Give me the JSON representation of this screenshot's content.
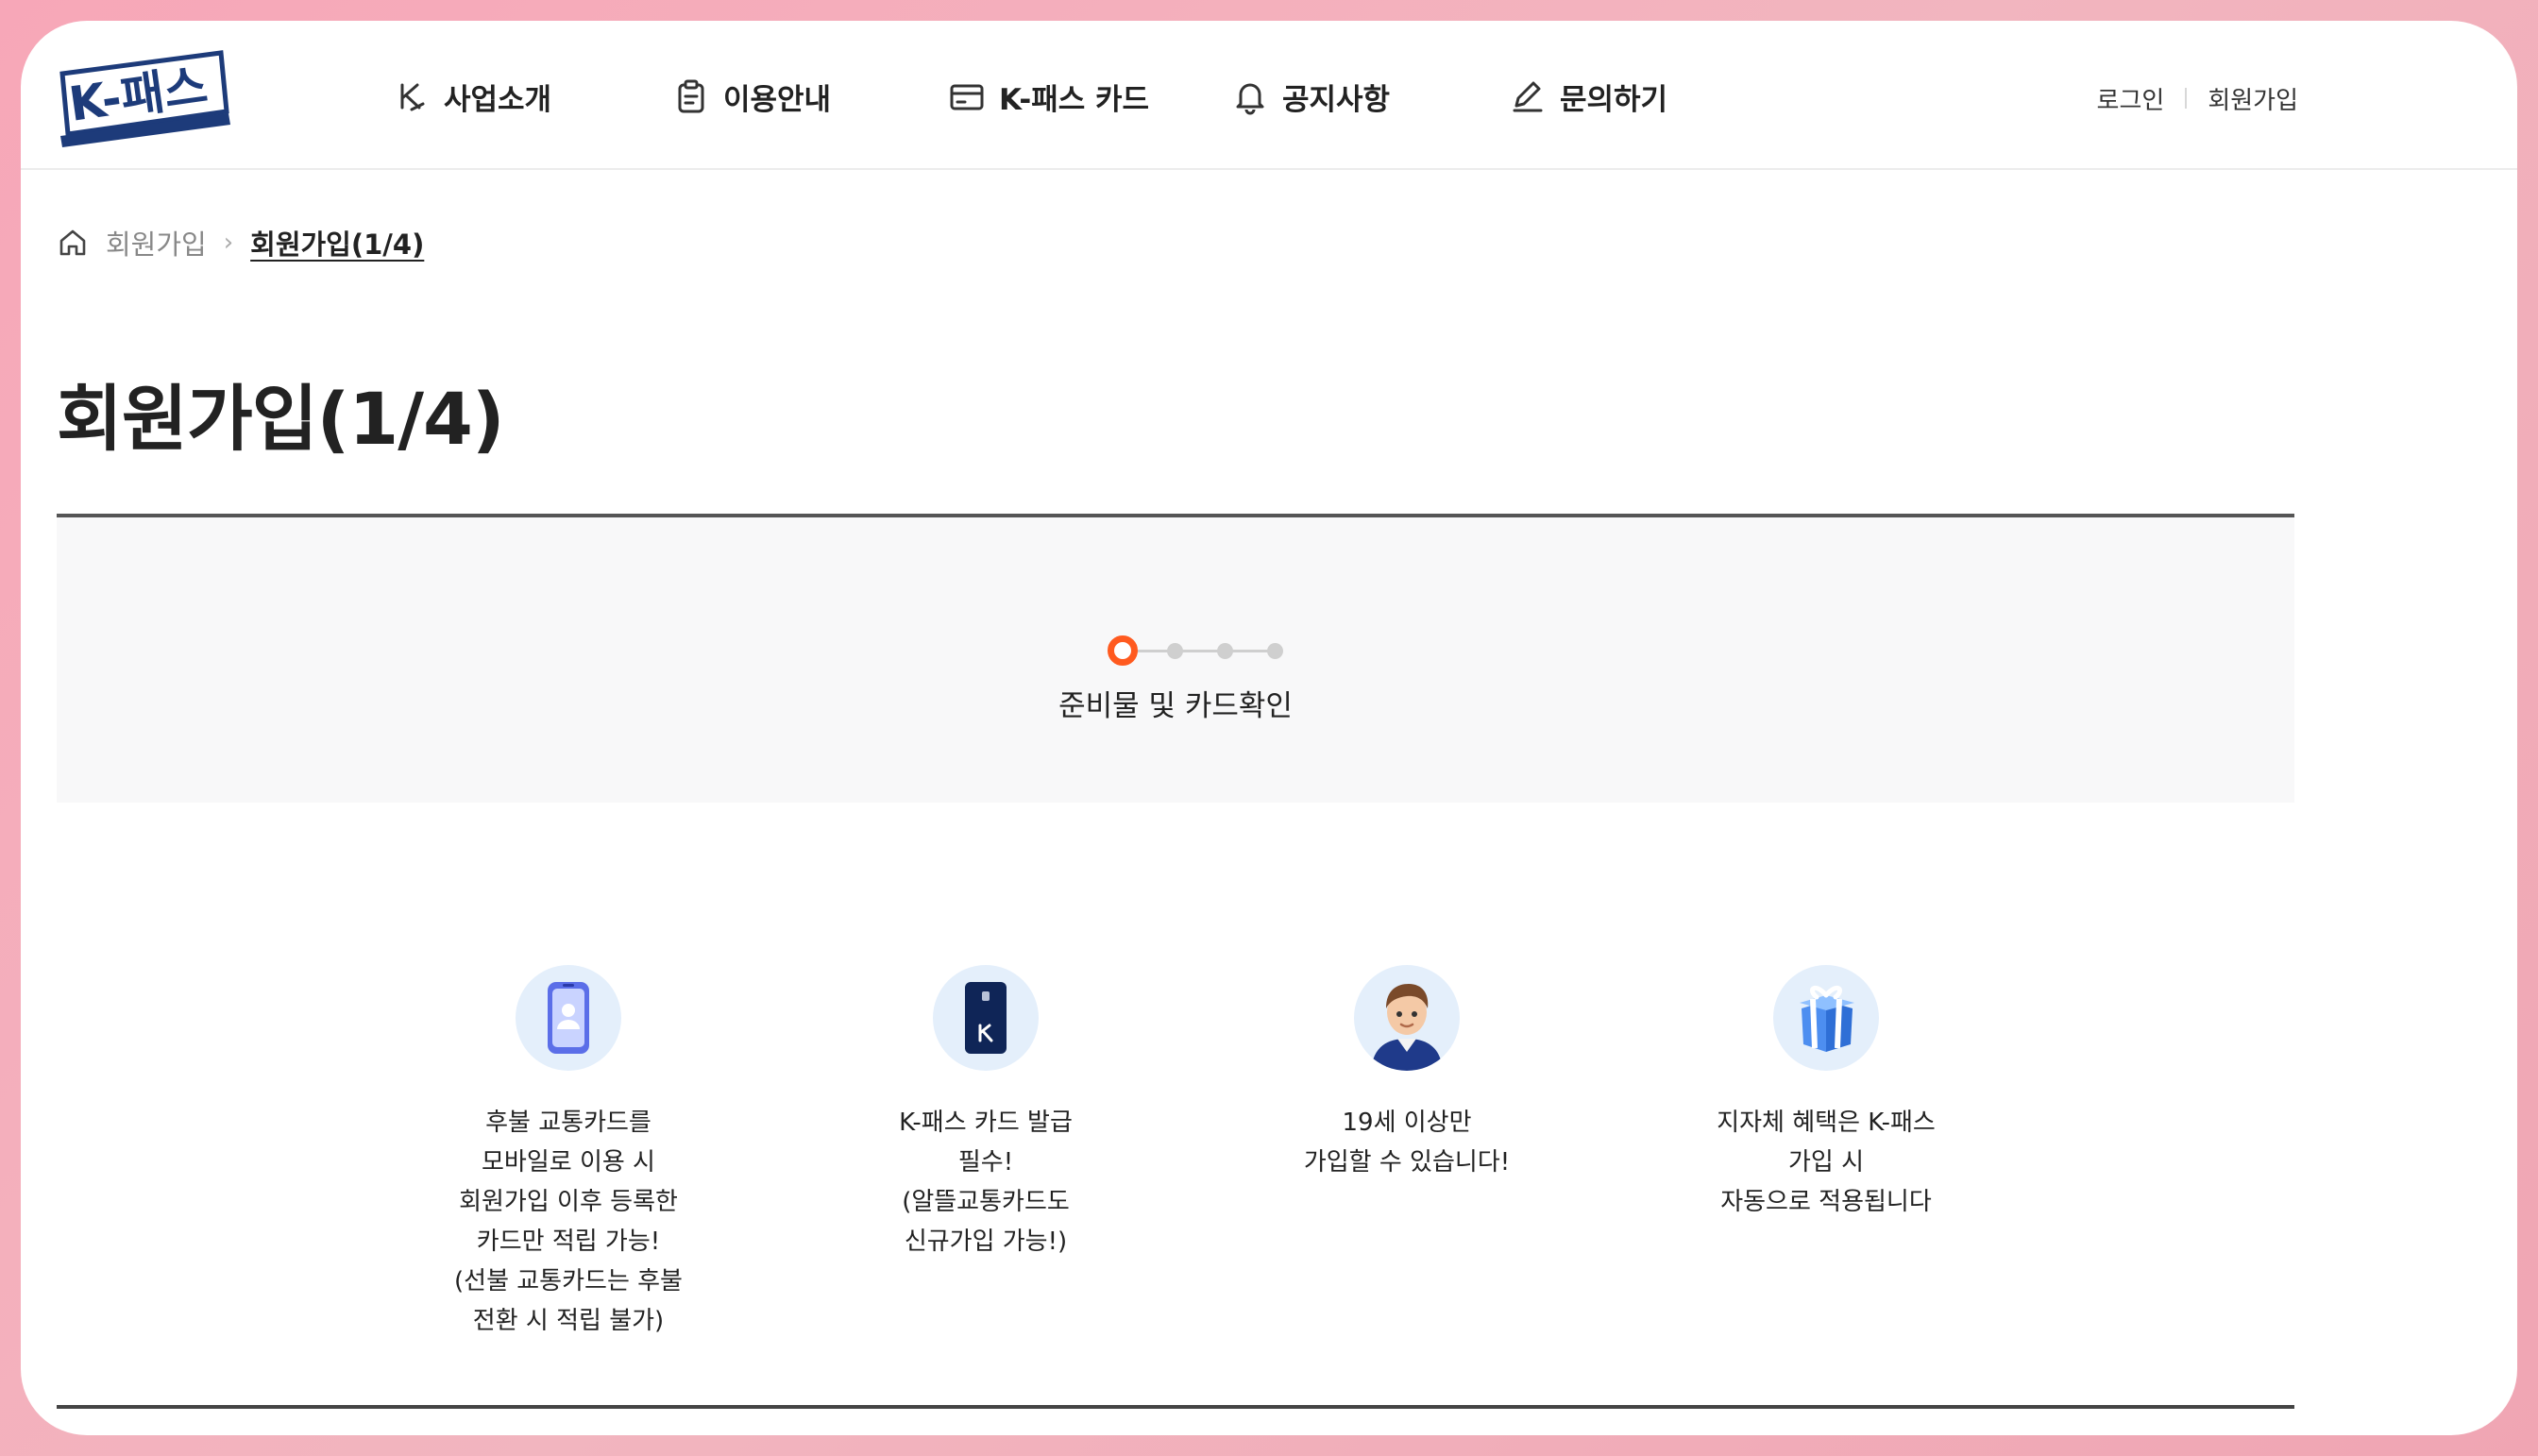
{
  "brand": {
    "logo_text": "K-패스",
    "logo_color": "#1d3b7a"
  },
  "nav": {
    "items": [
      {
        "label": "사업소개",
        "icon": "k-logo-icon"
      },
      {
        "label": "이용안내",
        "icon": "clipboard-icon"
      },
      {
        "label": "K-패스 카드",
        "icon": "card-icon"
      },
      {
        "label": "공지사항",
        "icon": "bell-icon"
      },
      {
        "label": "문의하기",
        "icon": "pencil-icon"
      }
    ]
  },
  "util": {
    "login": "로그인",
    "signup": "회원가입"
  },
  "breadcrumb": {
    "parent": "회원가입",
    "current": "회원가입(1/4)"
  },
  "page": {
    "title": "회원가입(1/4)"
  },
  "steps": {
    "total": 4,
    "current": 1,
    "label": "준비물 및 카드확인",
    "active_color": "#ff5a1f"
  },
  "features": [
    {
      "icon": "mobile-phone-icon",
      "text": "후불 교통카드를\n모바일로 이용 시\n회원가입 이후 등록한\n카드만 적립 가능!\n(선불 교통카드는 후불\n전환 시 적립 불가)"
    },
    {
      "icon": "k-pass-card-icon",
      "text": "K-패스 카드 발급\n필수!\n(알뜰교통카드도\n신규가입 가능!)"
    },
    {
      "icon": "person-avatar-icon",
      "text": "19세 이상만\n가입할 수 있습니다!"
    },
    {
      "icon": "gift-box-icon",
      "text": "지자체 혜택은 K-패스\n가입 시\n자동으로 적용됩니다"
    }
  ]
}
